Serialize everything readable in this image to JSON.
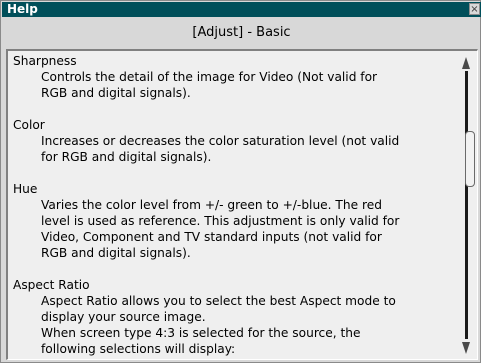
{
  "window": {
    "title": "Help",
    "close_glyph": "×",
    "header": "[Adjust] - Basic"
  },
  "sections": [
    {
      "title": "Sharpness",
      "body": "Controls the detail of the image for Video (Not valid for\nRGB and digital signals)."
    },
    {
      "title": "Color",
      "body": "Increases or decreases the color saturation level (not valid\nfor RGB and digital signals)."
    },
    {
      "title": "Hue",
      "body": "Varies the color level from +/- green to +/-blue. The red\nlevel is used as reference. This adjustment is only valid for\nVideo, Component and TV standard inputs (not valid for\nRGB and digital signals)."
    },
    {
      "title": "Aspect Ratio",
      "body": "Aspect Ratio allows you to select the best Aspect mode to\ndisplay your source image.\nWhen screen type 4:3 is selected for the source, the\nfollowing selections will display:"
    }
  ],
  "scrollbar": {
    "position_fraction": 0.25
  },
  "colors": {
    "titlebar": "#004f5a",
    "background": "#d8d8d8",
    "panel": "#efefef"
  }
}
